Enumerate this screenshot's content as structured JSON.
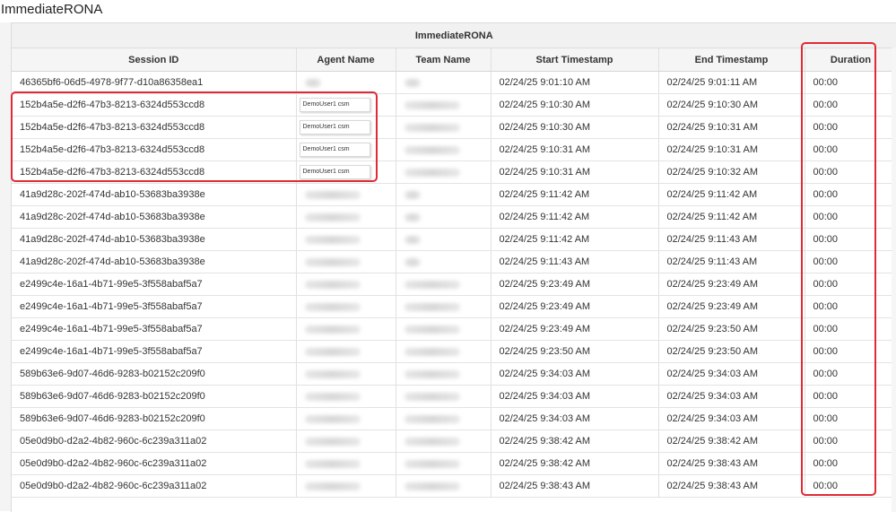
{
  "page": {
    "title": "ImmediateRONA"
  },
  "table": {
    "group_header": "ImmediateRONA",
    "columns": [
      "Session ID",
      "Agent Name",
      "Team Name",
      "Start Timestamp",
      "End Timestamp",
      "Duration"
    ],
    "rows": [
      {
        "session": "46365bf6-06d5-4978-9f77-d10a86358ea1",
        "agent": "",
        "team": "",
        "start": "02/24/25 9:01:10 AM",
        "end": "02/24/25 9:01:11 AM",
        "duration": "00:00"
      },
      {
        "session": "152b4a5e-d2f6-47b3-8213-6324d553ccd8",
        "agent": "DemoUser1 csm",
        "team": "",
        "start": "02/24/25 9:10:30 AM",
        "end": "02/24/25 9:10:30 AM",
        "duration": "00:00"
      },
      {
        "session": "152b4a5e-d2f6-47b3-8213-6324d553ccd8",
        "agent": "DemoUser1 csm",
        "team": "",
        "start": "02/24/25 9:10:30 AM",
        "end": "02/24/25 9:10:31 AM",
        "duration": "00:00"
      },
      {
        "session": "152b4a5e-d2f6-47b3-8213-6324d553ccd8",
        "agent": "DemoUser1 csm",
        "team": "",
        "start": "02/24/25 9:10:31 AM",
        "end": "02/24/25 9:10:31 AM",
        "duration": "00:00"
      },
      {
        "session": "152b4a5e-d2f6-47b3-8213-6324d553ccd8",
        "agent": "DemoUser1 csm",
        "team": "",
        "start": "02/24/25 9:10:31 AM",
        "end": "02/24/25 9:10:32 AM",
        "duration": "00:00"
      },
      {
        "session": "41a9d28c-202f-474d-ab10-53683ba3938e",
        "agent": "",
        "team": "",
        "start": "02/24/25 9:11:42 AM",
        "end": "02/24/25 9:11:42 AM",
        "duration": "00:00"
      },
      {
        "session": "41a9d28c-202f-474d-ab10-53683ba3938e",
        "agent": "",
        "team": "",
        "start": "02/24/25 9:11:42 AM",
        "end": "02/24/25 9:11:42 AM",
        "duration": "00:00"
      },
      {
        "session": "41a9d28c-202f-474d-ab10-53683ba3938e",
        "agent": "",
        "team": "",
        "start": "02/24/25 9:11:42 AM",
        "end": "02/24/25 9:11:43 AM",
        "duration": "00:00"
      },
      {
        "session": "41a9d28c-202f-474d-ab10-53683ba3938e",
        "agent": "",
        "team": "",
        "start": "02/24/25 9:11:43 AM",
        "end": "02/24/25 9:11:43 AM",
        "duration": "00:00"
      },
      {
        "session": "e2499c4e-16a1-4b71-99e5-3f558abaf5a7",
        "agent": "",
        "team": "",
        "start": "02/24/25 9:23:49 AM",
        "end": "02/24/25 9:23:49 AM",
        "duration": "00:00"
      },
      {
        "session": "e2499c4e-16a1-4b71-99e5-3f558abaf5a7",
        "agent": "",
        "team": "",
        "start": "02/24/25 9:23:49 AM",
        "end": "02/24/25 9:23:49 AM",
        "duration": "00:00"
      },
      {
        "session": "e2499c4e-16a1-4b71-99e5-3f558abaf5a7",
        "agent": "",
        "team": "",
        "start": "02/24/25 9:23:49 AM",
        "end": "02/24/25 9:23:50 AM",
        "duration": "00:00"
      },
      {
        "session": "e2499c4e-16a1-4b71-99e5-3f558abaf5a7",
        "agent": "",
        "team": "",
        "start": "02/24/25 9:23:50 AM",
        "end": "02/24/25 9:23:50 AM",
        "duration": "00:00"
      },
      {
        "session": "589b63e6-9d07-46d6-9283-b02152c209f0",
        "agent": "",
        "team": "",
        "start": "02/24/25 9:34:03 AM",
        "end": "02/24/25 9:34:03 AM",
        "duration": "00:00"
      },
      {
        "session": "589b63e6-9d07-46d6-9283-b02152c209f0",
        "agent": "",
        "team": "",
        "start": "02/24/25 9:34:03 AM",
        "end": "02/24/25 9:34:03 AM",
        "duration": "00:00"
      },
      {
        "session": "589b63e6-9d07-46d6-9283-b02152c209f0",
        "agent": "",
        "team": "",
        "start": "02/24/25 9:34:03 AM",
        "end": "02/24/25 9:34:03 AM",
        "duration": "00:00"
      },
      {
        "session": "05e0d9b0-d2a2-4b82-960c-6c239a311a02",
        "agent": "",
        "team": "",
        "start": "02/24/25 9:38:42 AM",
        "end": "02/24/25 9:38:42 AM",
        "duration": "00:00"
      },
      {
        "session": "05e0d9b0-d2a2-4b82-960c-6c239a311a02",
        "agent": "",
        "team": "",
        "start": "02/24/25 9:38:42 AM",
        "end": "02/24/25 9:38:43 AM",
        "duration": "00:00"
      },
      {
        "session": "05e0d9b0-d2a2-4b82-960c-6c239a311a02",
        "agent": "",
        "team": "",
        "start": "02/24/25 9:38:43 AM",
        "end": "02/24/25 9:38:43 AM",
        "duration": "00:00"
      }
    ]
  },
  "colors": {
    "highlight": "#e02a35"
  }
}
